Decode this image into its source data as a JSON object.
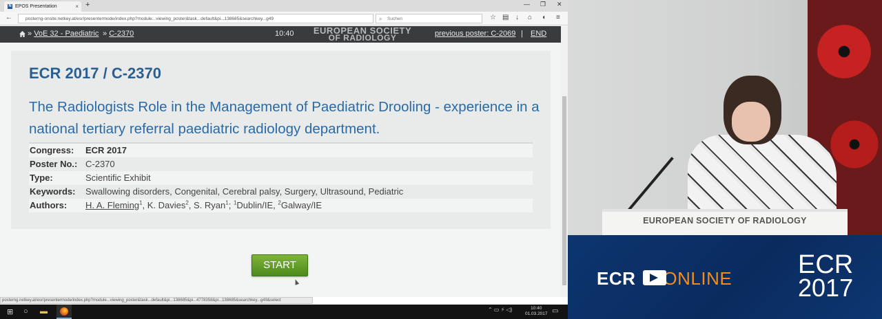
{
  "browser": {
    "tab_title": "EPOS Presentation",
    "tab_favicon": "N",
    "url": "posterng-onsite.netkey.at/esr/presentermode/index.php?module...viewing_poster&task...default&pi...138685&searchkey...g49",
    "search_placeholder": "Suchen",
    "status_url": "posterng.netkey.at/esr/presentermode/index.php?module...viewing_poster&task...default&pi...138685&pi...4778358&pi...138685&searchkey...g49&select"
  },
  "app_bar": {
    "crumb_1": "VoE 32 - Paediatric",
    "crumb_2": "C-2370",
    "clock": "10:40",
    "logo_line_1": "EUROPEAN SOCIETY",
    "logo_line_2": "OF RADIOLOGY",
    "prev_link": "previous poster: C-2069",
    "separator": "|",
    "end_link": "END"
  },
  "poster": {
    "id_title": "ECR 2017 / C-2370",
    "heading": "The Radiologists Role in the Management of Paediatric Drooling - experience in a national tertiary referral paediatric radiology department.",
    "fields": [
      {
        "label": "Congress:",
        "value": "ECR 2017"
      },
      {
        "label": "Poster No.:",
        "value": "C-2370"
      },
      {
        "label": "Type:",
        "value": "Scientific Exhibit"
      },
      {
        "label": "Keywords:",
        "value": "Swallowing disorders, Congenital, Cerebral palsy, Surgery, Ultrasound, Pediatric"
      },
      {
        "label": "Authors:",
        "author_1": "H. A. Fleming",
        "sup_1": "1",
        "author_2": ", K. Davies",
        "sup_2": "2",
        "author_3": ", S. Ryan",
        "sup_3": "1",
        "aff_sep": "; ",
        "sup_4": "1",
        "aff_1": "Dublin/IE, ",
        "sup_5": "2",
        "aff_2": "Galway/IE"
      }
    ],
    "start_label": "START"
  },
  "taskbar": {
    "time": "10:40",
    "date": "01.03.2017"
  },
  "stage": {
    "podium_label": "EUROPEAN SOCIETY OF RADIOLOGY"
  },
  "branding": {
    "ecr": "ECR",
    "online": "ONLINE",
    "year_top": "ECR",
    "year_bottom": "2017"
  },
  "colors": {
    "title_blue": "#2b5e91",
    "start_green": "#64a12a",
    "brand_navy": "#0b2c5a",
    "online_orange": "#f28c1c"
  }
}
